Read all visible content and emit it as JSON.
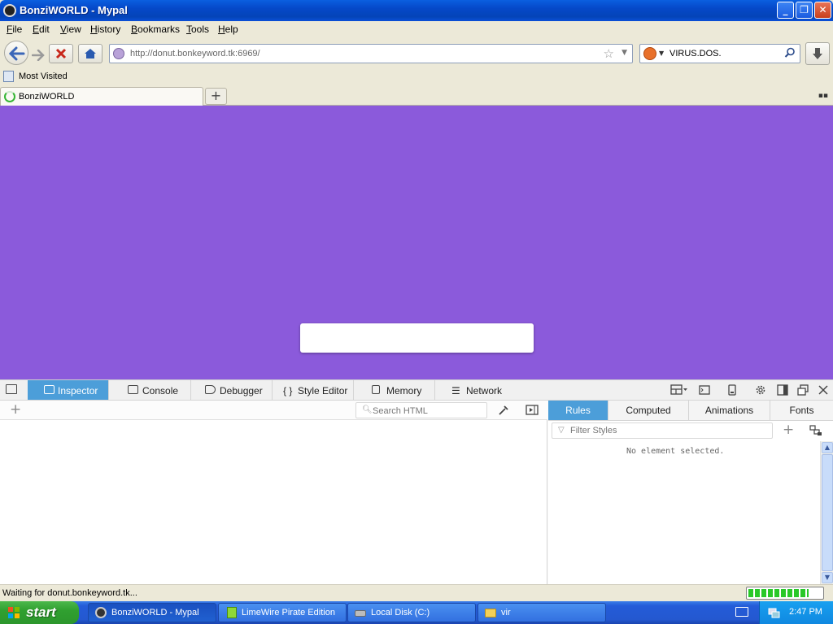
{
  "window": {
    "title": "BonziWORLD - Mypal"
  },
  "menu": {
    "items": [
      "File",
      "Edit",
      "View",
      "History",
      "Bookmarks",
      "Tools",
      "Help"
    ]
  },
  "nav": {
    "url": "http://donut.bonkeyword.tk:6969/",
    "search_value": "VIRUS.DOS."
  },
  "bookmarks": {
    "most_visited": "Most Visited"
  },
  "tabs": [
    {
      "label": "BonziWORLD",
      "loading": true
    }
  ],
  "page": {
    "background": "#8b5adb"
  },
  "devtools": {
    "tabs": [
      "Inspector",
      "Console",
      "Debugger",
      "Style Editor",
      "Memory",
      "Network"
    ],
    "active_tab": "Inspector",
    "search_html_placeholder": "Search HTML",
    "side_tabs": [
      "Rules",
      "Computed",
      "Animations",
      "Fonts"
    ],
    "active_side_tab": "Rules",
    "filter_styles_placeholder": "Filter Styles",
    "no_element_text": "No element selected."
  },
  "status": {
    "text": "Waiting for donut.bonkeyword.tk...",
    "progress": 0.82
  },
  "taskbar": {
    "start_label": "start",
    "tasks": [
      {
        "label": "BonziWORLD - Mypal",
        "active": true
      },
      {
        "label": "LimeWire Pirate Edition",
        "active": false
      },
      {
        "label": "Local Disk (C:)",
        "active": false
      },
      {
        "label": "vir",
        "active": false
      }
    ],
    "clock": "2:47 PM"
  }
}
